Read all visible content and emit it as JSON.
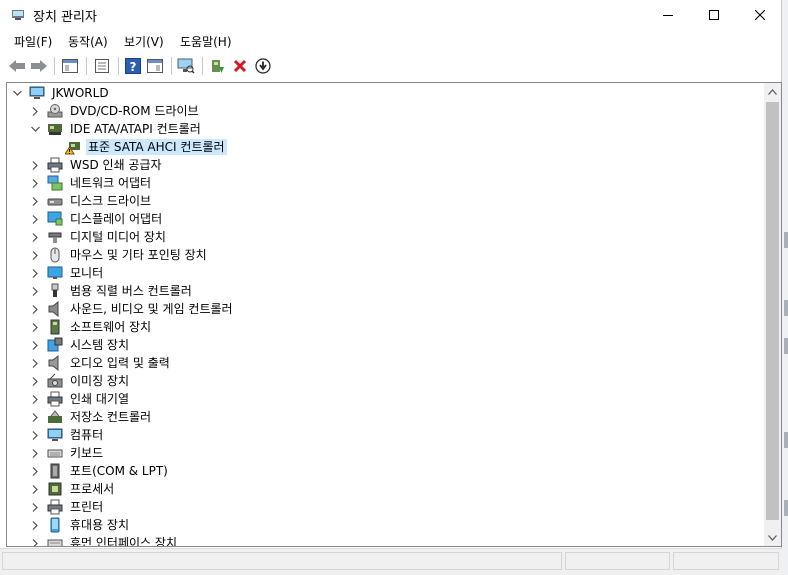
{
  "window": {
    "title": "장치 관리자"
  },
  "menu": [
    {
      "label": "파일(F)"
    },
    {
      "label": "동작(A)"
    },
    {
      "label": "보기(V)"
    },
    {
      "label": "도움말(H)"
    }
  ],
  "toolbar": {
    "icons": [
      "back-arrow-icon",
      "forward-arrow-icon",
      "show-hide-tree-icon",
      "properties-icon",
      "help-icon",
      "action-pane-icon",
      "scan-hardware-icon",
      "update-driver-icon",
      "uninstall-icon",
      "disable-device-icon"
    ]
  },
  "tree": {
    "root": "JKWORLD",
    "ide_children": [
      {
        "label": "표준 SATA AHCI 컨트롤러"
      }
    ],
    "categories": [
      {
        "label": "DVD/CD-ROM 드라이브",
        "icon": "dvd-drive-icon"
      },
      {
        "label": "IDE ATA/ATAPI 컨트롤러",
        "icon": "ide-controller-icon"
      },
      {
        "label": "WSD 인쇄 공급자",
        "icon": "printer-icon"
      },
      {
        "label": "네트워크 어댑터",
        "icon": "network-adapter-icon"
      },
      {
        "label": "디스크 드라이브",
        "icon": "disk-drive-icon"
      },
      {
        "label": "디스플레이 어댑터",
        "icon": "display-adapter-icon"
      },
      {
        "label": "디지털 미디어 장치",
        "icon": "digital-media-icon"
      },
      {
        "label": "마우스 및 기타 포인팅 장치",
        "icon": "mouse-icon"
      },
      {
        "label": "모니터",
        "icon": "monitor-icon"
      },
      {
        "label": "범용 직렬 버스 컨트롤러",
        "icon": "usb-icon"
      },
      {
        "label": "사운드, 비디오 및 게임 컨트롤러",
        "icon": "speaker-icon"
      },
      {
        "label": "소프트웨어 장치",
        "icon": "software-device-icon"
      },
      {
        "label": "시스템 장치",
        "icon": "system-device-icon"
      },
      {
        "label": "오디오 입력 및 출력",
        "icon": "audio-icon"
      },
      {
        "label": "이미징 장치",
        "icon": "camera-icon"
      },
      {
        "label": "인쇄 대기열",
        "icon": "print-queue-icon"
      },
      {
        "label": "저장소 컨트롤러",
        "icon": "storage-controller-icon"
      },
      {
        "label": "컴퓨터",
        "icon": "computer-icon"
      },
      {
        "label": "키보드",
        "icon": "keyboard-icon"
      },
      {
        "label": "포트(COM & LPT)",
        "icon": "port-icon"
      },
      {
        "label": "프로세서",
        "icon": "processor-icon"
      },
      {
        "label": "프린터",
        "icon": "printer-icon"
      },
      {
        "label": "휴대용 장치",
        "icon": "portable-device-icon"
      },
      {
        "label": "휴먼 인터페이스 장치",
        "icon": "hid-icon"
      }
    ]
  },
  "colors": {
    "selection": "#cce8ff",
    "window": "#ffffff",
    "chrome": "#f0f0f0"
  }
}
